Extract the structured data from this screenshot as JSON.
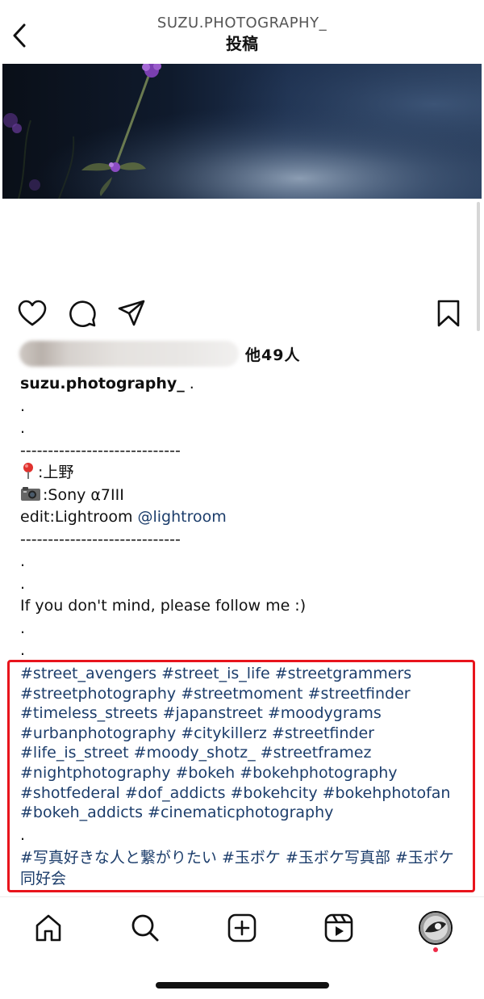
{
  "header": {
    "account": "SUZU.PHOTOGRAPHY_",
    "title": "投稿",
    "back_icon": "chevron-left-icon"
  },
  "post_image": {
    "description_icon": "flower-photo"
  },
  "actions": {
    "like_icon": "heart-icon",
    "comment_icon": "comment-icon",
    "share_icon": "paper-plane-icon",
    "save_icon": "bookmark-icon"
  },
  "likes": {
    "others": "他49人"
  },
  "caption": {
    "username": "suzu.photography_",
    "after_username": " .",
    "dot1": ".",
    "dot2": ".",
    "divider1": "-----------------------------",
    "location": ":上野",
    "camera": ":Sony α7III",
    "edit_prefix": "edit:Lightroom ",
    "edit_mention": "@lightroom",
    "divider2": "-----------------------------",
    "dot3": ".",
    "dot4": ".",
    "follow": "If you don't mind, please follow me :)",
    "dot5": ".",
    "dot6": "."
  },
  "hashtags": {
    "lines": [
      "#street_avengers #street_is_life #streetgrammers",
      "#streetphotography #streetmoment #streetfinder",
      "#timeless_streets #japanstreet #moodygrams",
      "#urbanphotography #citykillerz #streetfinder",
      "#life_is_street #moody_shotz_ #streetframez",
      "#nightphotography #bokeh #bokehphotography",
      "#shotfederal #dof_addicts #bokehcity #bokehphotofan",
      "#bokeh_addicts #cinematicphotography"
    ],
    "dot": ".",
    "japanese": "#写真好きな人と繋がりたい #玉ボケ #玉ボケ写真部 #玉ボケ同好会"
  },
  "bottom_nav": {
    "home_icon": "home-icon",
    "search_icon": "search-icon",
    "create_icon": "plus-square-icon",
    "reels_icon": "reels-icon",
    "profile_icon": "profile-avatar"
  },
  "colors": {
    "link": "#1c3d6b",
    "highlight": "#e8141c",
    "notification": "#ef2a47"
  }
}
